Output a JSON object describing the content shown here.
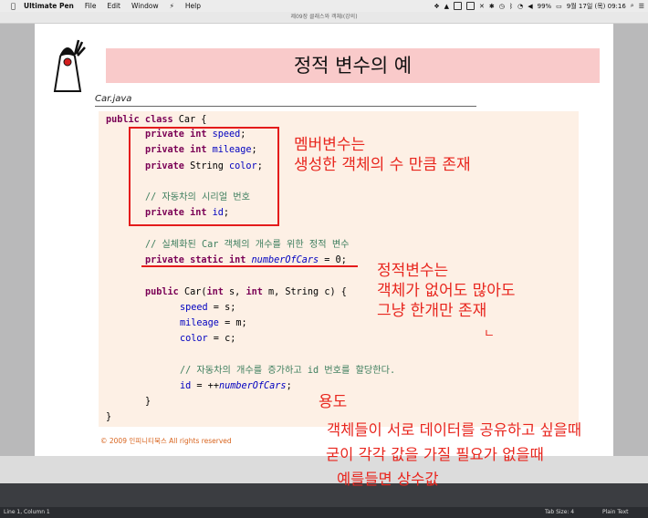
{
  "menubar": {
    "app_name": "Ultimate Pen",
    "items": [
      "File",
      "Edit",
      "Window",
      "Help"
    ],
    "battery": "99%",
    "datetime": "9월 17일 (목) 09:16"
  },
  "window": {
    "title": "제09장 클래스와 객체I(강의)"
  },
  "slide": {
    "title": "정적 변수의 예",
    "file_name": "Car.java",
    "copyright": "© 2009 인피니티북스  All rights reserved",
    "code": {
      "line1_kw": "public class",
      "line1_rest": " Car {",
      "f_speed_kw": "private int ",
      "f_speed_name": "speed",
      "f_mileage_kw": "private int ",
      "f_mileage_name": "mileage",
      "f_color_kw": "private ",
      "f_color_type": "String ",
      "f_color_name": "color",
      "comment_serial": "// 자동차의 시리얼 번호",
      "f_id_kw": "private int ",
      "f_id_name": "id",
      "comment_static": "// 실체화된 Car 객체의 개수를 위한 정적 변수",
      "static_kw": "private static int ",
      "static_name": "numberOfCars",
      "static_rest": " = 0;",
      "ctor_kw": "public ",
      "ctor_sig1": "Car(",
      "ctor_int": "int ",
      "ctor_sig2": "s, ",
      "ctor_int2": "int ",
      "ctor_sig3": "m, String c) {",
      "assign_speed": "speed",
      "assign_speed_rest": " = s;",
      "assign_mileage": "mileage",
      "assign_mileage_rest": " = m;",
      "assign_color": "color",
      "assign_color_rest": " = c;",
      "comment_count": "// 자동차의 개수를 증가하고 id 번호를 할당한다.",
      "assign_id": "id",
      "assign_id_mid": " = ++",
      "assign_id_static": "numberOfCars",
      "assign_id_end": ";",
      "close_inner": "}",
      "close_outer": "}"
    },
    "annotations": {
      "member_vars": "멤버변수는\n생성한 객체의 수 만큼 존재",
      "static_vars": "정적변수는\n객체가 없어도 많아도\n그냥 한개만 존재",
      "static_mark": "ㄴ",
      "usage_title": "용도",
      "usage_line1": "객체들이 서로 데이터를 공유하고 싶을때",
      "usage_line2": "굳이 각각 값을 가질 필요가 없을때",
      "usage_line3": "예를들면 상수값"
    }
  },
  "statusbar": {
    "position": "Line 1, Column 1",
    "tab_size": "Tab Size: 4",
    "syntax": "Plain Text"
  },
  "colors": {
    "annotation_red": "#e8261e",
    "title_band": "#f9caca",
    "code_background": "#fdf0e5"
  }
}
